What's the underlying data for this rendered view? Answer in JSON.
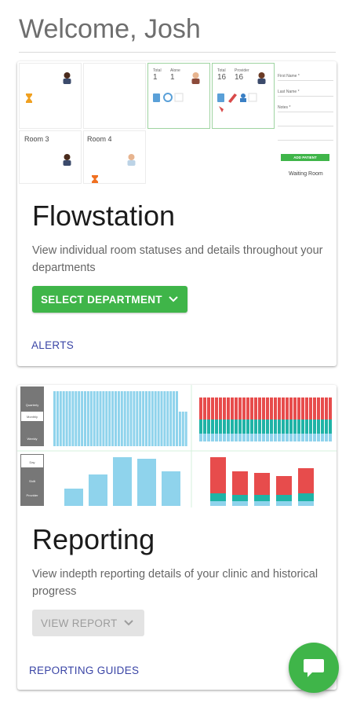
{
  "header": {
    "welcome": "Welcome, Josh"
  },
  "flowstation": {
    "title": "Flowstation",
    "description": "View individual room statuses and details throughout your departments",
    "select_button": "SELECT DEPARTMENT",
    "alerts_link": "ALERTS",
    "preview": {
      "room3": "Room 3",
      "room4": "Room 4",
      "tile1_total_label": "Total",
      "tile1_total_value": "1",
      "tile1_alone_label": "Alone",
      "tile1_alone_value": "1",
      "tile2_total_label": "Total",
      "tile2_total_value": "16",
      "tile2_provider_label": "Provider",
      "tile2_provider_value": "16",
      "form_first_name": "First Name *",
      "form_last_name": "Last Name *",
      "form_notes": "Notes *",
      "add_patient": "ADD PATIENT",
      "waiting_room": "Waiting Room"
    }
  },
  "reporting": {
    "title": "Reporting",
    "description": "View indepth reporting details of your clinic and historical progress",
    "view_button": "VIEW REPORT",
    "guides_link": "REPORTING GUIDES",
    "preview": {
      "period_options": [
        "Quarterly",
        "Monthly",
        "Weekly"
      ],
      "metric_options": [
        "Day",
        "Shift",
        "Provider"
      ]
    }
  },
  "colors": {
    "green": "#3fb549",
    "link": "#3a45a6",
    "bar_blue": "#8fd3ec",
    "bar_red": "#e74c4c",
    "bar_teal": "#1fb3a6"
  }
}
